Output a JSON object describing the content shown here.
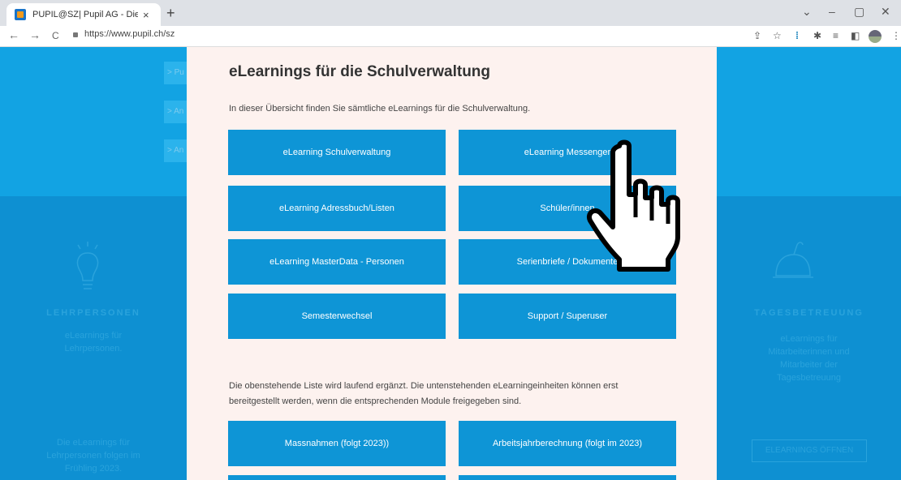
{
  "browser": {
    "tab_title": "PUPIL@SZ| Pupil AG - Die eLearn",
    "tab_close": "×",
    "new_tab": "+",
    "url": "https://www.pupil.ch/sz",
    "nav": {
      "back": "←",
      "forward": "→",
      "reload": "C"
    },
    "window": {
      "dropdown": "⌄",
      "minimize": "–",
      "restore": "▢",
      "close": "✕"
    }
  },
  "background": {
    "left_buttons": [
      "> Pu",
      "> An",
      "> An"
    ],
    "left_heading": "LEHRPERSONEN",
    "left_text": [
      "eLearnings für",
      "Lehrpersonen."
    ],
    "left_footer": [
      "Die eLearnings für",
      "Lehrpersonen folgen im",
      "Frühling 2023."
    ],
    "right_heading": "TAGESBETREUUNG",
    "right_text": [
      "eLearnings für",
      "Mitarbeiterinnen und",
      "Mitarbeiter der",
      "Tagesbetreuung"
    ],
    "right_button": "ELEARNINGS ÖFFNEN"
  },
  "modal": {
    "title": "eLearnings für die Schulverwaltung",
    "intro": "In dieser Übersicht finden Sie sämtliche eLearnings für die Schulverwaltung.",
    "tiles": [
      "eLearning Schulverwaltung",
      "eLearning Messenger",
      "eLearning Adressbuch/Listen",
      "Schüler/innen",
      "eLearning MasterData - Personen",
      "Serienbriefe / Dokumente",
      "Semesterwechsel",
      "Support / Superuser"
    ],
    "note": "Die obenstehende Liste wird laufend ergänzt. Die untenstehenden eLearningeinheiten können erst bereitgestellt werden, wenn die entsprechenden Module freigegeben sind.",
    "future_tiles": [
      "Massnahmen (folgt 2023))",
      "Arbeitsjahrberechnung (folgt im 2023)"
    ]
  },
  "colors": {
    "accent": "#0e95d6",
    "modal_bg": "#fdf2ef",
    "page_bg": "#0e90d2"
  }
}
